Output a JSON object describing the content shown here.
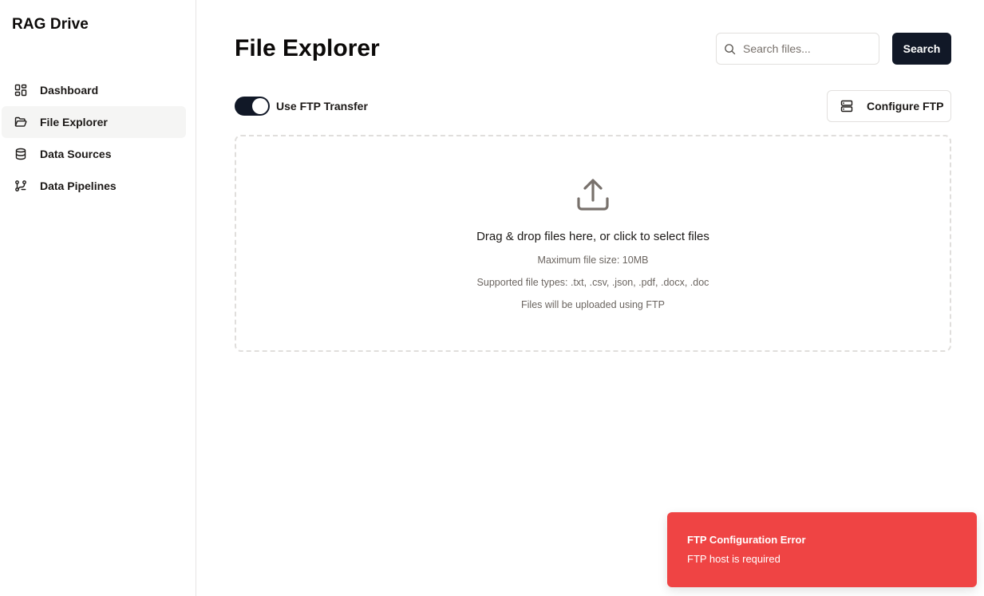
{
  "app": {
    "title": "RAG Drive"
  },
  "sidebar": {
    "items": [
      {
        "label": "Dashboard",
        "icon": "dashboard-icon",
        "active": false
      },
      {
        "label": "File Explorer",
        "icon": "folder-open-icon",
        "active": true
      },
      {
        "label": "Data Sources",
        "icon": "database-icon",
        "active": false
      },
      {
        "label": "Data Pipelines",
        "icon": "pipeline-icon",
        "active": false
      }
    ]
  },
  "header": {
    "title": "File Explorer",
    "search": {
      "placeholder": "Search files...",
      "value": "",
      "button_label": "Search",
      "icon": "search-icon"
    }
  },
  "ftp": {
    "toggle_label": "Use FTP Transfer",
    "toggle_on": true,
    "configure_label": "Configure FTP",
    "configure_icon": "server-icon"
  },
  "dropzone": {
    "icon": "upload-icon",
    "main_text": "Drag & drop files here, or click to select files",
    "max_size": "Maximum file size: 10MB",
    "file_types": "Supported file types: .txt, .csv, .json, .pdf, .docx, .doc",
    "transfer_note": "Files will be uploaded using FTP"
  },
  "toast": {
    "title": "FTP Configuration Error",
    "description": "FTP host is required"
  },
  "colors": {
    "primary": "#111827",
    "error": "#ef4444",
    "active_nav_bg": "#f5f5f4",
    "muted_text": "#6b6560"
  }
}
